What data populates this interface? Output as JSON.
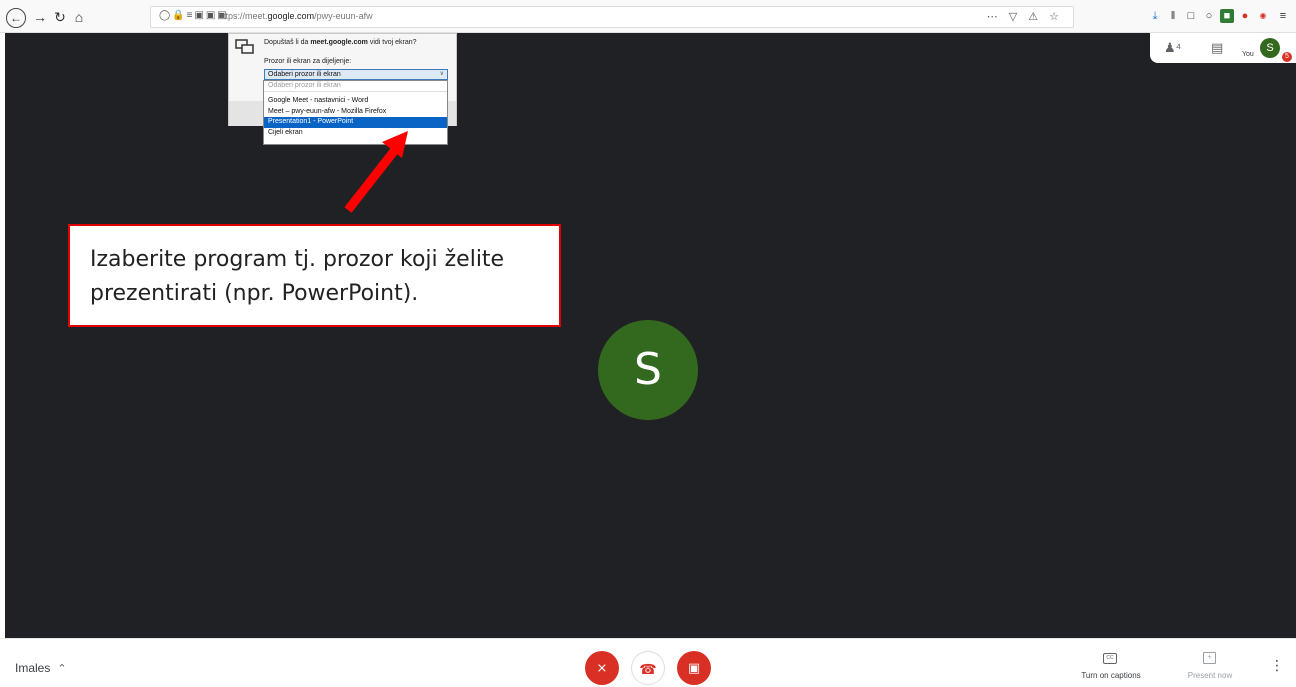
{
  "browser": {
    "url_prefix": "https://meet.",
    "url_domain": "google.com",
    "url_suffix": "/pwy-euun-afw",
    "url_actions": "⋯ ▽ ⚠ ☆"
  },
  "meet_panel": {
    "you_label": "You",
    "avatar_initial": "S",
    "badge_count": "5"
  },
  "share_dialog": {
    "question_before": "Dopuštaš li da ",
    "question_domain": "meet.google.com",
    "question_after": " vidi tvoj ekran?",
    "field_label": "Prozor ili ekran za dijeljenje:",
    "selected_value": "Odaberi prozor ili ekran",
    "options": [
      "Odaberi prozor ili ekran",
      "Google Meet - nastavnici - Word",
      "Meet – pwy-euun-afw - Mozilla Firefox",
      "Presentation1 - PowerPoint",
      "Cijeli ekran"
    ]
  },
  "annotation": {
    "text": "Izaberite program tj. prozor koji želite prezentirati (npr. PowerPoint).",
    "accent_color": "#e00000"
  },
  "participant": {
    "initial": "S",
    "avatar_color": "#33691e"
  },
  "bottom_bar": {
    "meeting_name": "Imales",
    "captions_label": "Turn on captions",
    "present_label": "Present now"
  },
  "icons": {
    "back": "arrow-left-icon",
    "forward": "arrow-right-icon",
    "reload": "reload-icon",
    "home": "home-icon",
    "people": "people-icon",
    "chat": "chat-icon",
    "mic_off": "mic-off-icon",
    "hangup": "hangup-icon",
    "cam_off": "camera-off-icon",
    "captions": "captions-icon",
    "present": "present-icon",
    "more": "more-vert-icon"
  }
}
